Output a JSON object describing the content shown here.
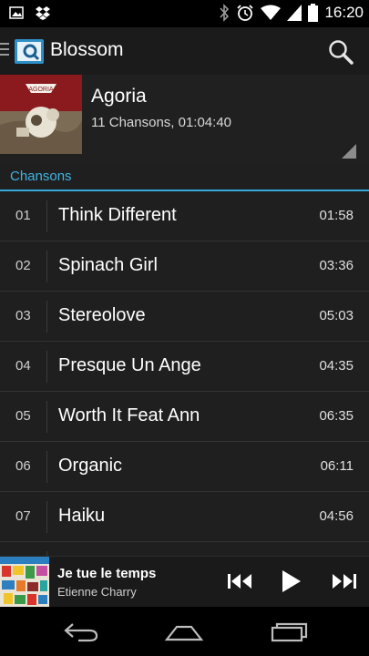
{
  "status_bar": {
    "time": "16:20",
    "left_icons": [
      "image-icon",
      "dropbox-icon"
    ],
    "right_icons": [
      "bluetooth-icon",
      "alarm-icon",
      "wifi-icon",
      "signal-icon",
      "battery-icon"
    ]
  },
  "action_bar": {
    "title": "Blossom",
    "icons": [
      "drawer-icon",
      "app-icon",
      "search-icon"
    ]
  },
  "album": {
    "title": "Agoria",
    "meta": "11 Chansons, 01:04:40",
    "cover_text": "AGORIA"
  },
  "section": {
    "label": "Chansons"
  },
  "tracks": [
    {
      "num": "01",
      "title": "Think Different",
      "duration": "01:58"
    },
    {
      "num": "02",
      "title": "Spinach Girl",
      "duration": "03:36"
    },
    {
      "num": "03",
      "title": "Stereolove",
      "duration": "05:03"
    },
    {
      "num": "04",
      "title": "Presque Un Ange",
      "duration": "04:35"
    },
    {
      "num": "05",
      "title": "Worth It Feat Ann",
      "duration": "06:35"
    },
    {
      "num": "06",
      "title": "Organic",
      "duration": "06:11"
    },
    {
      "num": "07",
      "title": "Haiku",
      "duration": "04:56"
    },
    {
      "num": "",
      "title": "",
      "duration": ""
    }
  ],
  "now_playing": {
    "title": "Je tue le temps",
    "artist": "Etienne Charry",
    "controls": [
      "previous-icon",
      "play-icon",
      "next-icon"
    ]
  },
  "nav_bar": {
    "icons": [
      "back-icon",
      "home-icon",
      "recent-apps-icon"
    ]
  },
  "colors": {
    "accent": "#33a8d9",
    "background": "#1f1f1f",
    "status_bar": "#000000"
  }
}
